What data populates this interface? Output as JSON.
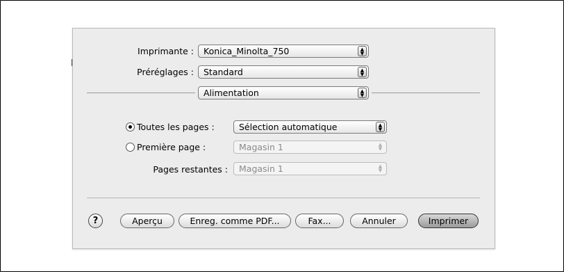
{
  "printer": {
    "label": "Imprimante :",
    "value": "Konica_Minolta_750"
  },
  "presets": {
    "label": "Préréglages :",
    "value": "Standard"
  },
  "panel_select": {
    "value": "Alimentation"
  },
  "paper_feed": {
    "all_pages": {
      "label": "Toutes les pages :",
      "value": "Sélection automatique",
      "selected": true
    },
    "first_page": {
      "label": "Première page :",
      "value": "Magasin 1",
      "selected": false
    },
    "remaining_pages": {
      "label": "Pages restantes :",
      "value": "Magasin 1"
    }
  },
  "buttons": {
    "help": "?",
    "preview": "Aperçu",
    "save_pdf": "Enreg. comme PDF...",
    "fax": "Fax...",
    "cancel": "Annuler",
    "print": "Imprimer"
  },
  "icons": {
    "popup_arrows": "up-down-arrows-icon",
    "help": "help-icon"
  }
}
